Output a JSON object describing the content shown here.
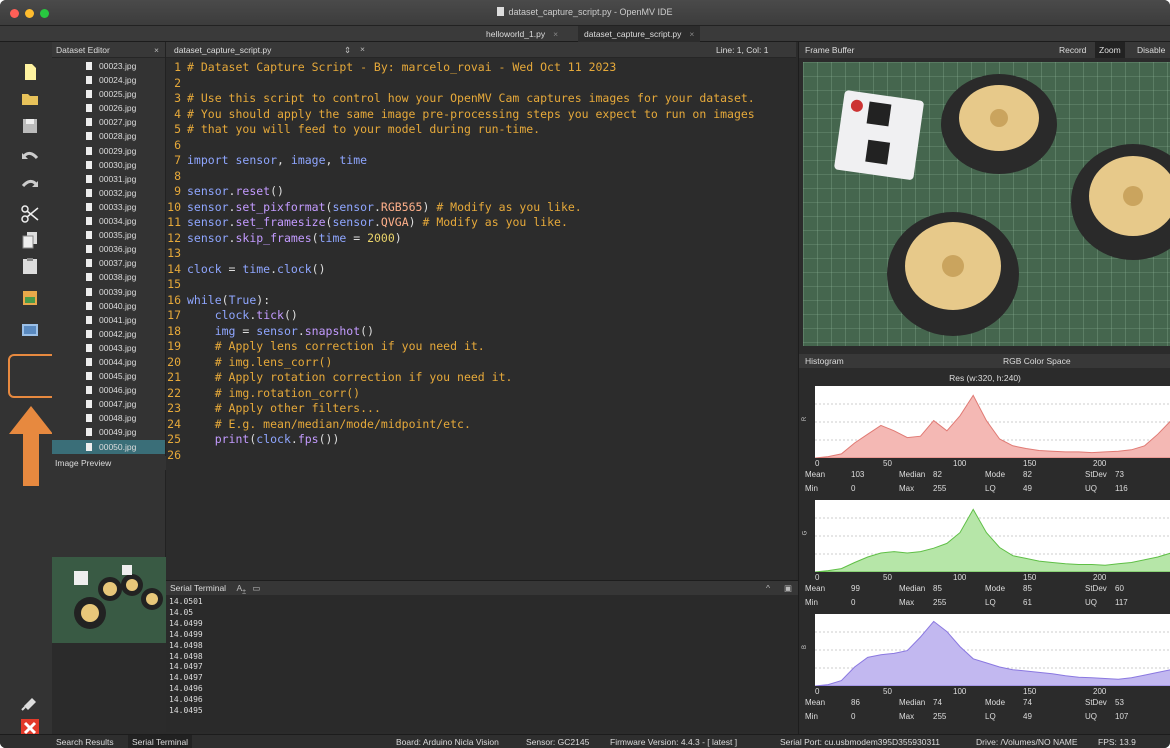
{
  "window": {
    "title": "dataset_capture_script.py - OpenMV IDE"
  },
  "editor_tabs": [
    {
      "label": "helloworld_1.py"
    },
    {
      "label": "dataset_capture_script.py"
    }
  ],
  "dataset_editor": {
    "title": "Dataset Editor",
    "files": [
      "00023.jpg",
      "00024.jpg",
      "00025.jpg",
      "00026.jpg",
      "00027.jpg",
      "00028.jpg",
      "00029.jpg",
      "00030.jpg",
      "00031.jpg",
      "00032.jpg",
      "00033.jpg",
      "00034.jpg",
      "00035.jpg",
      "00036.jpg",
      "00037.jpg",
      "00038.jpg",
      "00039.jpg",
      "00040.jpg",
      "00041.jpg",
      "00042.jpg",
      "00043.jpg",
      "00044.jpg",
      "00045.jpg",
      "00046.jpg",
      "00047.jpg",
      "00048.jpg",
      "00049.jpg",
      "00050.jpg"
    ],
    "selected": "00050.jpg",
    "image_preview_label": "Image Preview"
  },
  "editor": {
    "file_name": "dataset_capture_script.py",
    "position": "Line: 1, Col: 1",
    "lines": [
      "# Dataset Capture Script - By: marcelo_rovai - Wed Oct 11 2023",
      "",
      "# Use this script to control how your OpenMV Cam captures images for your dataset.",
      "# You should apply the same image pre-processing steps you expect to run on images",
      "# that you will feed to your model during run-time.",
      "",
      "import sensor, image, time",
      "",
      "sensor.reset()",
      "sensor.set_pixformat(sensor.RGB565) # Modify as you like.",
      "sensor.set_framesize(sensor.QVGA) # Modify as you like.",
      "sensor.skip_frames(time = 2000)",
      "",
      "clock = time.clock()",
      "",
      "while(True):",
      "    clock.tick()",
      "    img = sensor.snapshot()",
      "    # Apply lens correction if you need it.",
      "    # img.lens_corr()",
      "    # Apply rotation correction if you need it.",
      "    # img.rotation_corr()",
      "    # Apply other filters...",
      "    # E.g. mean/median/mode/midpoint/etc.",
      "    print(clock.fps())",
      ""
    ]
  },
  "serial_terminal": {
    "title": "Serial Terminal",
    "lines": [
      "14.0501",
      "14.05",
      "14.0499",
      "14.0499",
      "14.0498",
      "14.0498",
      "14.0497",
      "14.0497",
      "14.0496",
      "14.0496",
      "14.0495"
    ]
  },
  "frame_buffer": {
    "title": "Frame Buffer",
    "buttons": [
      "Record",
      "Zoom",
      "Disable"
    ]
  },
  "histogram": {
    "title": "Histogram",
    "color_space": "RGB Color Space",
    "resolution": "Res (w:320, h:240)",
    "ticks": [
      "0",
      "50",
      "100",
      "150",
      "200"
    ],
    "channels": [
      {
        "name": "R",
        "color": "#f4b8b4",
        "stats": {
          "Mean": "103",
          "Median": "82",
          "Mode": "82",
          "StDev": "73",
          "Min": "0",
          "Max": "255",
          "LQ": "49",
          "UQ": "116"
        }
      },
      {
        "name": "G",
        "color": "#b6e6a8",
        "stats": {
          "Mean": "99",
          "Median": "85",
          "Mode": "85",
          "StDev": "60",
          "Min": "0",
          "Max": "255",
          "LQ": "61",
          "UQ": "117"
        }
      },
      {
        "name": "B",
        "color": "#c2b8f0",
        "stats": {
          "Mean": "86",
          "Median": "74",
          "Mode": "74",
          "StDev": "53",
          "Min": "0",
          "Max": "255",
          "LQ": "49",
          "UQ": "107"
        }
      }
    ]
  },
  "bottom_tabs": [
    "Search Results",
    "Serial Terminal"
  ],
  "status": {
    "board": "Board: Arduino Nicla Vision",
    "sensor": "Sensor: GC2145",
    "firmware": "Firmware Version: 4.4.3 - [ latest ]",
    "port": "Serial Port: cu.usbmodem395D355930311",
    "drive": "Drive: /Volumes/NO NAME",
    "fps": "FPS: 13.9"
  }
}
